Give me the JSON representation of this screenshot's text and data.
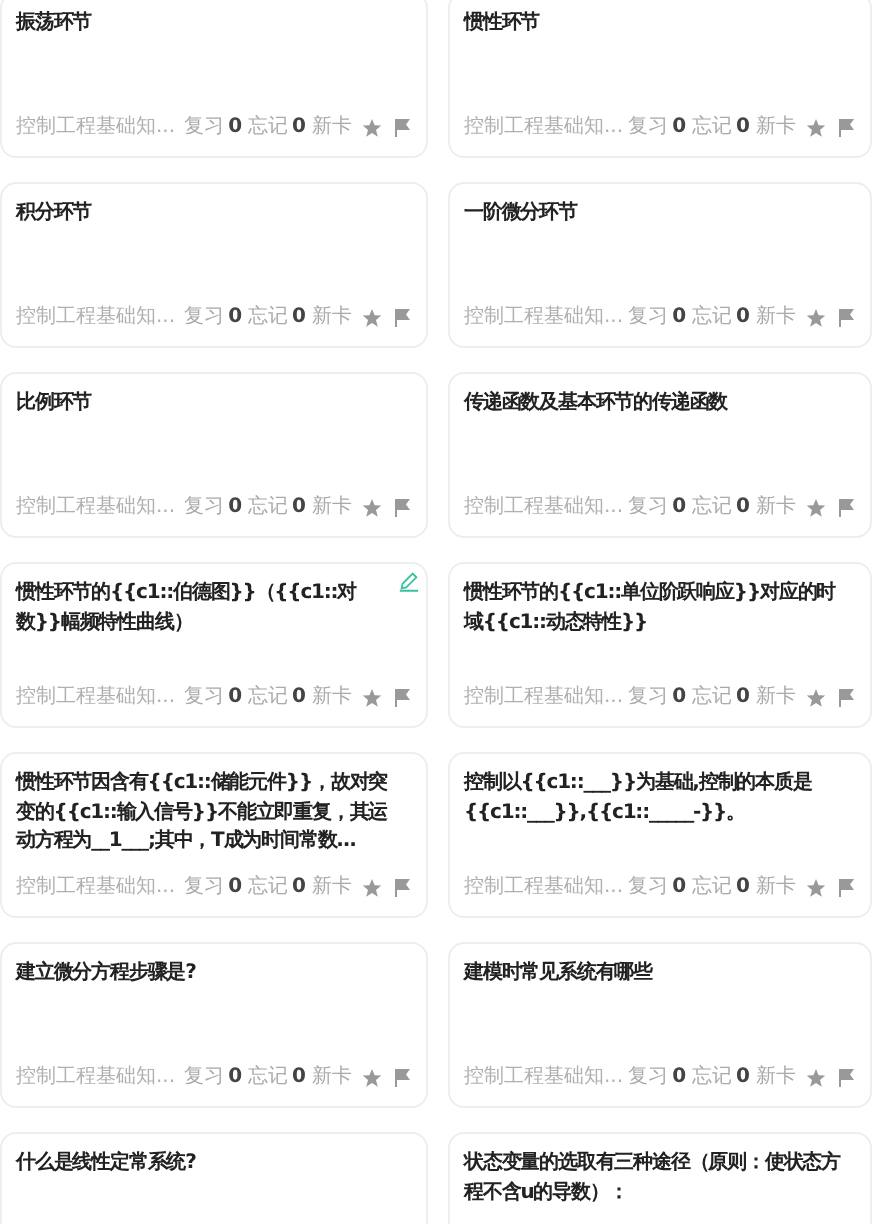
{
  "cards": [
    {
      "title": "振荡环节",
      "deck": "控制工程基础知...",
      "review_label": "复习",
      "review": "0",
      "forgot_label": "忘记",
      "forgot": "0",
      "new_label": "新卡",
      "editing": false
    },
    {
      "title": "惯性环节",
      "deck": "控制工程基础知...",
      "review_label": "复习",
      "review": "0",
      "forgot_label": "忘记",
      "forgot": "0",
      "new_label": "新卡",
      "editing": false
    },
    {
      "title": "积分环节",
      "deck": "控制工程基础知...",
      "review_label": "复习",
      "review": "0",
      "forgot_label": "忘记",
      "forgot": "0",
      "new_label": "新卡",
      "editing": false
    },
    {
      "title": "一阶微分环节",
      "deck": "控制工程基础知...",
      "review_label": "复习",
      "review": "0",
      "forgot_label": "忘记",
      "forgot": "0",
      "new_label": "新卡",
      "editing": false
    },
    {
      "title": "比例环节",
      "deck": "控制工程基础知...",
      "review_label": "复习",
      "review": "0",
      "forgot_label": "忘记",
      "forgot": "0",
      "new_label": "新卡",
      "editing": false
    },
    {
      "title": "传递函数及基本环节的传递函数",
      "deck": "控制工程基础知...",
      "review_label": "复习",
      "review": "0",
      "forgot_label": "忘记",
      "forgot": "0",
      "new_label": "新卡",
      "editing": false
    },
    {
      "title": "惯性环节的{{c1::伯德图}}（{{c1::对数}}幅频特性曲线）",
      "deck": "控制工程基础知...",
      "review_label": "复习",
      "review": "0",
      "forgot_label": "忘记",
      "forgot": "0",
      "new_label": "新卡",
      "editing": true
    },
    {
      "title": "惯性环节的{{c1::单位阶跃响应}}对应的时域{{c1::动态特性}}",
      "deck": "控制工程基础知...",
      "review_label": "复习",
      "review": "0",
      "forgot_label": "忘记",
      "forgot": "0",
      "new_label": "新卡",
      "editing": false
    },
    {
      "title": "惯性环节因含有{{c1::储能元件}}，故对突变的{{c1::输入信号}}不能立即重复，其运动方程为__1___;其中，T成为时间常数...",
      "deck": "控制工程基础知...",
      "review_label": "复习",
      "review": "0",
      "forgot_label": "忘记",
      "forgot": "0",
      "new_label": "新卡",
      "editing": false
    },
    {
      "title": "控制以{{c1::___}}为基础,控制的本质是{{c1::___}},{{c1::_____-}}。",
      "deck": "控制工程基础知...",
      "review_label": "复习",
      "review": "0",
      "forgot_label": "忘记",
      "forgot": "0",
      "new_label": "新卡",
      "editing": false
    },
    {
      "title": "建立微分方程步骤是?",
      "deck": "控制工程基础知...",
      "review_label": "复习",
      "review": "0",
      "forgot_label": "忘记",
      "forgot": "0",
      "new_label": "新卡",
      "editing": false
    },
    {
      "title": "建模时常见系统有哪些",
      "deck": "控制工程基础知...",
      "review_label": "复习",
      "review": "0",
      "forgot_label": "忘记",
      "forgot": "0",
      "new_label": "新卡",
      "editing": false
    },
    {
      "title": "什么是线性定常系统?",
      "editing": false
    },
    {
      "title": "状态变量的选取有三种途径（原则：使状态方程不含u的导数）：",
      "editing": false
    }
  ]
}
